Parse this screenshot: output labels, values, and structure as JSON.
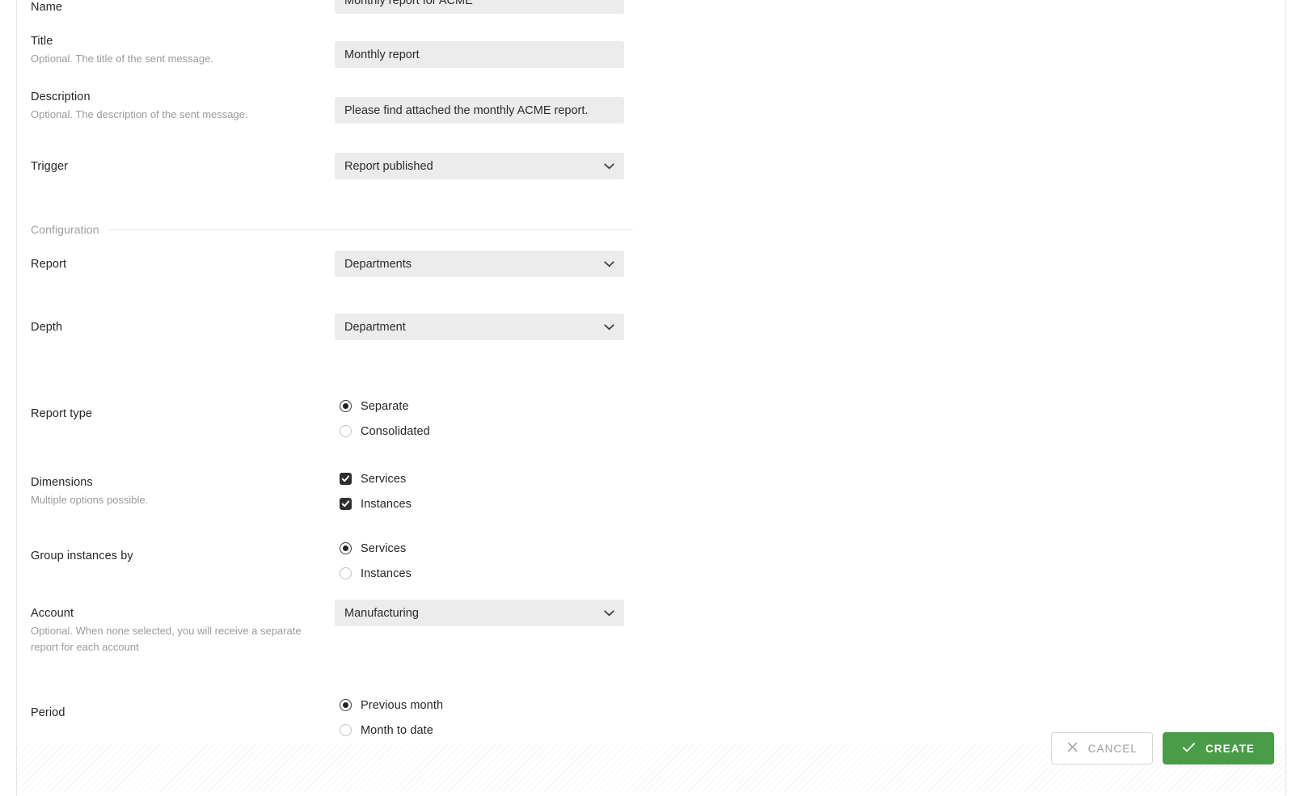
{
  "theme": {
    "accent_green": "#4a9c48",
    "input_background": "#ececec",
    "label_color": "#262626",
    "help_color": "#9b9b9b"
  },
  "form": {
    "fields": {
      "name": {
        "label": "Name",
        "value": "Monthly report for ACME"
      },
      "title": {
        "label": "Title",
        "help": "Optional. The title of the sent message.",
        "value": "Monthly report"
      },
      "description": {
        "label": "Description",
        "help": "Optional. The description of the sent message.",
        "value": "Please find attached the monthly ACME report."
      },
      "trigger": {
        "label": "Trigger",
        "value": "Report published"
      },
      "report": {
        "label": "Report",
        "value": "Departments"
      },
      "depth": {
        "label": "Depth",
        "value": "Department"
      },
      "report_type": {
        "label": "Report type",
        "options": [
          {
            "label": "Separate",
            "selected": true
          },
          {
            "label": "Consolidated",
            "selected": false
          }
        ]
      },
      "dimensions": {
        "label": "Dimensions",
        "help": "Multiple options possible.",
        "options": [
          {
            "label": "Services",
            "checked": true
          },
          {
            "label": "Instances",
            "checked": true
          }
        ]
      },
      "group_instances_by": {
        "label": "Group instances by",
        "options": [
          {
            "label": "Services",
            "selected": true
          },
          {
            "label": "Instances",
            "selected": false
          }
        ]
      },
      "account": {
        "label": "Account",
        "help": "Optional. When none selected, you will receive a separate report for each account",
        "value": "Manufacturing"
      },
      "period": {
        "label": "Period",
        "options": [
          {
            "label": "Previous month",
            "selected": true
          },
          {
            "label": "Month to date",
            "selected": false
          }
        ]
      }
    },
    "section_configuration": {
      "title": "Configuration"
    }
  },
  "footer": {
    "cancel_label": "CANCEL",
    "create_label": "CREATE"
  }
}
